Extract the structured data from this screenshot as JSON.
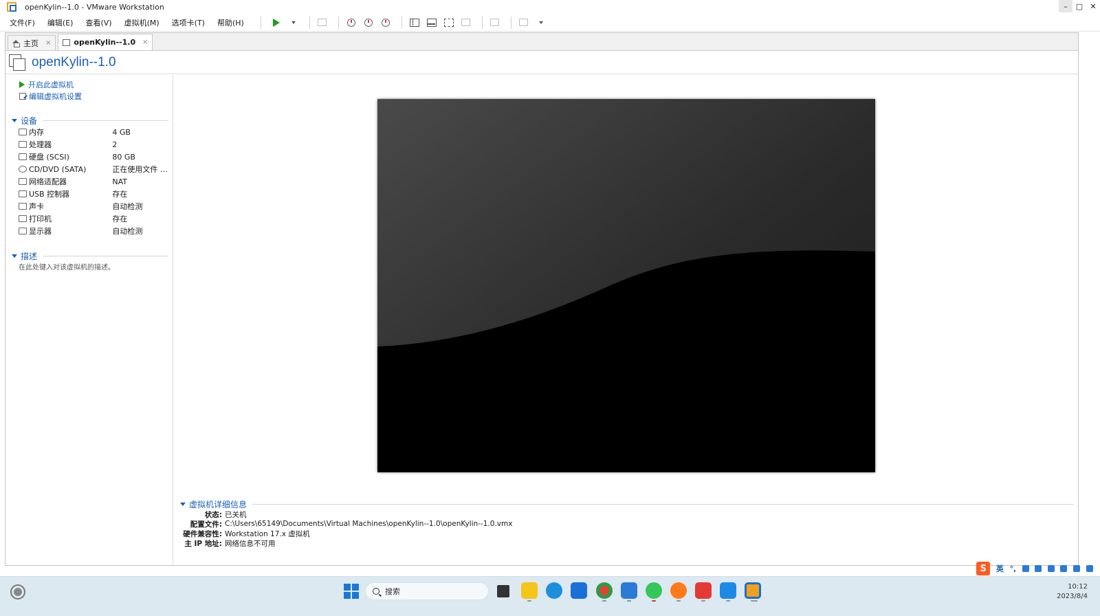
{
  "window": {
    "title": "openKylin--1.0 - VMware Workstation",
    "controls": [
      "–",
      "▢",
      "✕"
    ]
  },
  "menu": [
    "文件(F)",
    "编辑(E)",
    "查看(V)",
    "虚拟机(M)",
    "选项卡(T)",
    "帮助(H)"
  ],
  "tabs": [
    {
      "label": "主页",
      "close": "×"
    },
    {
      "label": "openKylin--1.0",
      "close": "×"
    }
  ],
  "vm": {
    "title": "openKylin--1.0"
  },
  "actions": {
    "power_on": "开启此虚拟机",
    "edit_settings": "编辑虚拟机设置"
  },
  "devices": {
    "header": "设备",
    "rows": [
      {
        "name": "内存",
        "value": "4 GB",
        "icon": "memory-icon"
      },
      {
        "name": "处理器",
        "value": "2",
        "icon": "cpu-icon"
      },
      {
        "name": "硬盘 (SCSI)",
        "value": "80 GB",
        "icon": "disk-icon"
      },
      {
        "name": "CD/DVD (SATA)",
        "value": "正在使用文件 C:...",
        "icon": "cd-icon"
      },
      {
        "name": "网络适配器",
        "value": "NAT",
        "icon": "network-icon"
      },
      {
        "name": "USB 控制器",
        "value": "存在",
        "icon": "usb-icon"
      },
      {
        "name": "声卡",
        "value": "自动检测",
        "icon": "sound-icon"
      },
      {
        "name": "打印机",
        "value": "存在",
        "icon": "printer-icon"
      },
      {
        "name": "显示器",
        "value": "自动检测",
        "icon": "display-icon"
      }
    ]
  },
  "description": {
    "header": "描述",
    "placeholder": "在此处键入对该虚拟机的描述。"
  },
  "details": {
    "header": "虚拟机详细信息",
    "rows": [
      {
        "label": "状态:",
        "value": "已关机"
      },
      {
        "label": "配置文件:",
        "value": "C:\\Users\\65149\\Documents\\Virtual Machines\\openKylin--1.0\\openKylin--1.0.vmx"
      },
      {
        "label": "硬件兼容性:",
        "value": "Workstation 17.x 虚拟机"
      },
      {
        "label": "主 IP 地址:",
        "value": "网络信息不可用"
      }
    ]
  },
  "ime": {
    "logo": "S",
    "mode": "英",
    "punct": "°,"
  },
  "taskbar": {
    "search_placeholder": "搜索",
    "time": "10:12",
    "date": "2023/8/4"
  },
  "colors": {
    "accent": "#1a5fb4",
    "play": "#1a9e1a",
    "taskbar": "#dde9f1"
  }
}
